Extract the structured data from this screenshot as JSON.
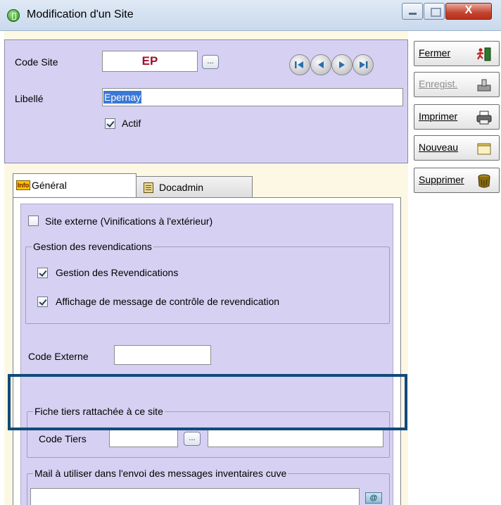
{
  "window": {
    "title": "Modification d'un Site",
    "close_symbol": "X"
  },
  "header": {
    "code_site_label": "Code Site",
    "code_site_value": "EP",
    "browse_label": "...",
    "libelle_label": "Libellé",
    "libelle_value": "Epernay",
    "actif_label": "Actif",
    "actif_checked": true,
    "nav_buttons": [
      "first-record",
      "previous-record",
      "next-record",
      "last-record"
    ]
  },
  "tabs": [
    {
      "label": "Général",
      "icon": "info-icon",
      "active": true
    },
    {
      "label": "Docadmin",
      "icon": "document-icon",
      "active": false
    }
  ],
  "general": {
    "site_externe_label": "Site externe (Vinifications à l'extérieur)",
    "site_externe_checked": false,
    "revendications_group_title": "Gestion des revendications",
    "gestion_revendications_label": "Gestion des Revendications",
    "gestion_revendications_checked": true,
    "affichage_message_label": "Affichage de message de contrôle de revendication",
    "affichage_message_checked": true,
    "code_externe_label": "Code Externe",
    "code_externe_value": "",
    "fiche_tiers_group_title": "Fiche tiers rattachée à ce site",
    "code_tiers_label": "Code Tiers",
    "code_tiers_value": "",
    "tiers_name_value": "",
    "browse_label": "...",
    "mail_group_title": "Mail à utiliser dans l'envoi des messages inventaires cuve",
    "mail_value": "",
    "mail_icon_text": "@"
  },
  "actions": [
    {
      "label": "Fermer",
      "icon": "exit-icon",
      "enabled": true
    },
    {
      "label": "Enregist.",
      "icon": "save-icon",
      "enabled": false
    },
    {
      "label": "Imprimer",
      "icon": "printer-icon",
      "enabled": true
    },
    {
      "label": "Nouveau",
      "icon": "new-document-icon",
      "enabled": true
    },
    {
      "label": "Supprimer",
      "icon": "delete-icon",
      "enabled": true
    }
  ],
  "colors": {
    "panel_background": "#d6d0f2",
    "code_text": "#a0102a",
    "highlight_border": "#114a7a",
    "selection": "#3a78d8"
  }
}
